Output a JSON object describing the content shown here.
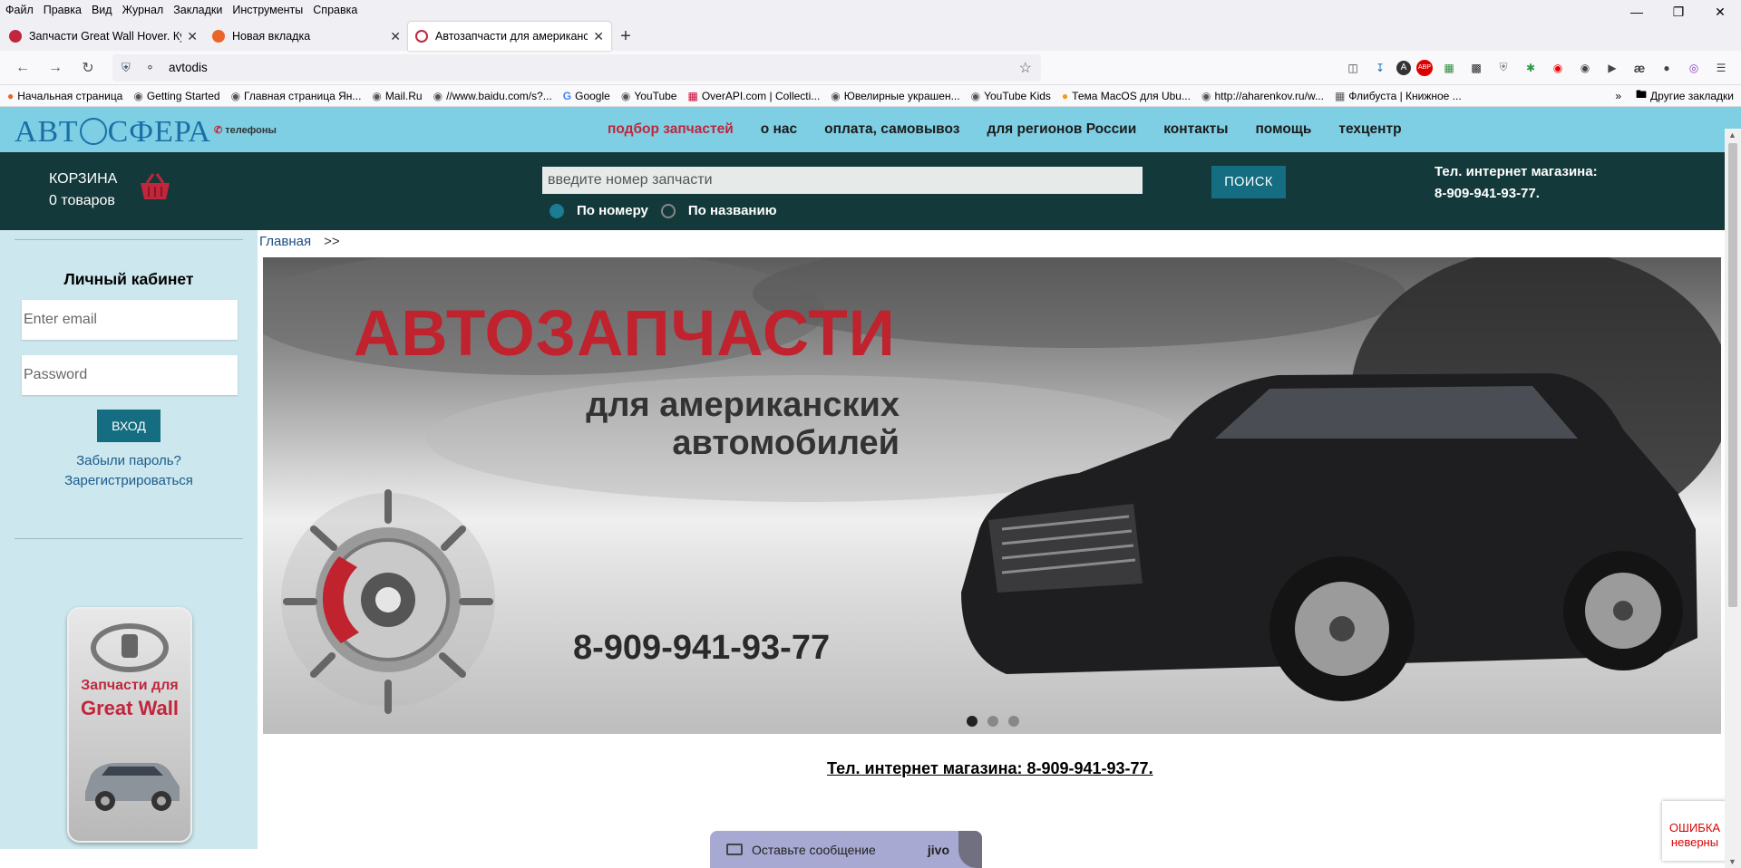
{
  "menu": [
    "Файл",
    "Правка",
    "Вид",
    "Журнал",
    "Закладки",
    "Инструменты",
    "Справка"
  ],
  "tabs": [
    {
      "title": "Запчасти Great Wall Hover. Куп",
      "color": "#c0263c",
      "active": false
    },
    {
      "title": "Новая вкладка",
      "color": "#e8662a",
      "active": false
    },
    {
      "title": "Автозапчасти для американск",
      "color": "#c0263c",
      "active": true
    }
  ],
  "url": "avtodis",
  "bookmarks": [
    "Начальная страница",
    "Getting Started",
    "Главная страница Ян...",
    "Mail.Ru",
    "//www.baidu.com/s?...",
    "Google",
    "YouTube",
    "OverAPI.com | Collecti...",
    "Ювелирные украшен...",
    "YouTube Kids",
    "Тема MacOS для Ubu...",
    "http://aharenkov.ru/w...",
    "Флибуста | Книжное ..."
  ],
  "other_bookmarks": "Другие закладки",
  "site": {
    "logo": {
      "left": "АВТ",
      "right": "СФЕРА"
    },
    "phones_link": "телефоны",
    "nav": [
      "подбор запчастей",
      "о нас",
      "оплата, самовывоз",
      "для регионов России",
      "контакты",
      "помощь",
      "техцентр"
    ],
    "cart": {
      "label": "КОРЗИНА",
      "count": "0 товаров"
    },
    "search": {
      "placeholder": "введите номер запчасти",
      "button": "ПОИСК",
      "by_number": "По номеру",
      "by_name": "По названию"
    },
    "shop_phone": {
      "label": "Тел. интернет магазина:",
      "number": "8-909-941-93-77."
    },
    "breadcrumb": {
      "home": "Главная",
      "sep": ">>"
    },
    "cabinet": {
      "title": "Личный кабинет",
      "email_ph": "Enter email",
      "password_ph": "Password",
      "login": "ВХОД",
      "forgot": "Забыли пароль?",
      "register": "Зарегистрироваться"
    },
    "gw_banner": {
      "line1": "Запчасти для",
      "line2": "Great Wall"
    },
    "slide": {
      "headline": "АВТОЗАПЧАСТИ",
      "sub1": "для американских",
      "sub2": "автомобилей",
      "phone": "8-909-941-93-77"
    },
    "bottom_phone": "Тел. интернет магазина: 8-909-941-93-77.",
    "chat": {
      "label": "Оставьте сообщение",
      "brand": "jivo"
    },
    "recaptcha": {
      "line1": "ОШИБКА",
      "line2": "неверны"
    }
  }
}
